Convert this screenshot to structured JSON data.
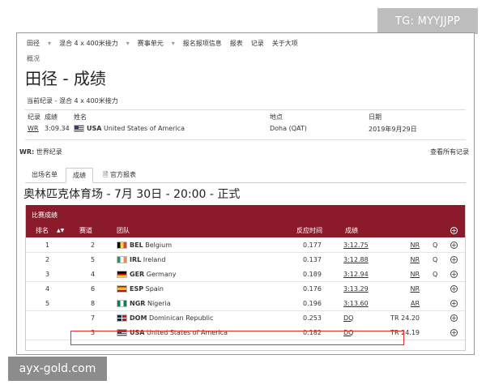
{
  "watermark_top": "TG: MYYJJPP",
  "watermark_bottom": "ayx-gold.com",
  "nav": [
    "田径",
    "混合 4 x 400米接力",
    "赛事单元",
    "报名报项信息",
    "报表",
    "记录",
    "关于大项"
  ],
  "breadcrumb": "概况",
  "page_title": "田径 - 成绩",
  "record_title": "当前纪录 - 混合 4 x 400米接力",
  "record_table": {
    "headers": {
      "record": "纪录",
      "result": "成绩",
      "name": "姓名",
      "venue": "地点",
      "date": "日期"
    },
    "row": {
      "record": "WR",
      "result": "3:09.34",
      "country_code": "USA",
      "country_name": "United States of America",
      "venue": "Doha (QAT)",
      "date": "2019年9月29日"
    }
  },
  "wr_legend": {
    "code": "WR:",
    "text": "世界纪录"
  },
  "all_records": "查看所有记录",
  "tabs": [
    "出场名单",
    "成绩",
    "官方报表"
  ],
  "venue_title": "奥林匹克体育场 - 7月 30日 - 20:00 - 正式",
  "results": {
    "caption": "比赛成绩",
    "headers": {
      "rank": "排名",
      "lane": "赛道",
      "team": "团队",
      "reaction": "反应时间",
      "mark": "成绩"
    },
    "rows": [
      {
        "rank": "1",
        "lane": "2",
        "code": "BEL",
        "country": "Belgium",
        "reaction": "0.177",
        "mark": "3:12.75",
        "flag_label": "NR",
        "q": "Q"
      },
      {
        "rank": "2",
        "lane": "5",
        "code": "IRL",
        "country": "Ireland",
        "reaction": "0.137",
        "mark": "3:12.88",
        "flag_label": "NR",
        "q": "Q"
      },
      {
        "rank": "3",
        "lane": "4",
        "code": "GER",
        "country": "Germany",
        "reaction": "0.189",
        "mark": "3:12.94",
        "flag_label": "NR",
        "q": "Q"
      },
      {
        "rank": "4",
        "lane": "6",
        "code": "ESP",
        "country": "Spain",
        "reaction": "0.176",
        "mark": "3:13.29",
        "flag_label": "NR",
        "q": ""
      },
      {
        "rank": "5",
        "lane": "8",
        "code": "NGR",
        "country": "Nigeria",
        "reaction": "0.196",
        "mark": "3:13.60",
        "flag_label": "AR",
        "q": ""
      },
      {
        "rank": "",
        "lane": "7",
        "code": "DOM",
        "country": "Dominican Republic",
        "reaction": "0.253",
        "mark": "DQ",
        "flag_label": "TR 24.20",
        "q": ""
      },
      {
        "rank": "",
        "lane": "3",
        "code": "USA",
        "country": "United States of America",
        "reaction": "0.182",
        "mark": "DQ",
        "flag_label": "TR 24.19",
        "q": ""
      }
    ]
  },
  "expand_symbol": "+"
}
